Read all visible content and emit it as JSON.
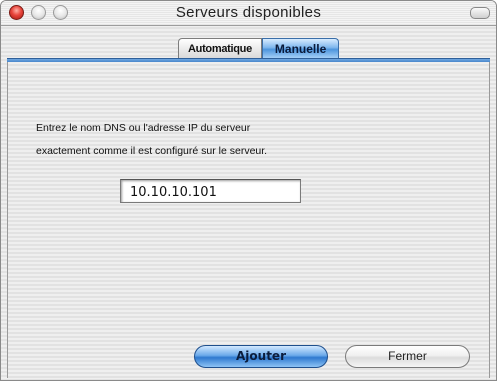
{
  "window": {
    "title": "Serveurs disponibles"
  },
  "tabs": [
    {
      "label": "Automatique",
      "selected": false
    },
    {
      "label": "Manuelle",
      "selected": true
    }
  ],
  "instructions": {
    "line1": "Entrez le nom DNS ou l'adresse IP du serveur",
    "line2": "exactement comme il est configuré sur le serveur."
  },
  "server_field": {
    "value": "10.10.10.101"
  },
  "buttons": {
    "add_label": "Ajouter",
    "close_label": "Fermer"
  },
  "colors": {
    "accent": "#4d95dd",
    "close_light": "#e8453c"
  }
}
